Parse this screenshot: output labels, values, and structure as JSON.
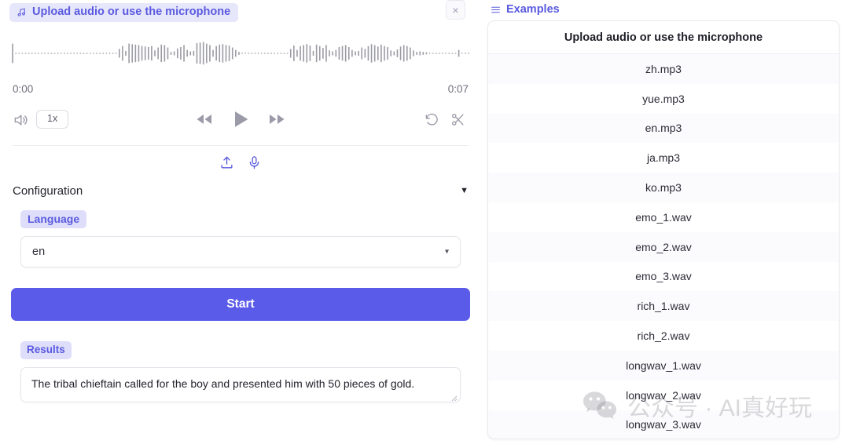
{
  "left": {
    "file_badge": {
      "label": "Upload audio or use the microphone",
      "icon": "music-note-icon"
    },
    "close_icon": "×",
    "player": {
      "time_start": "0:00",
      "time_end": "0:07",
      "speed": "1x",
      "volume_icon": "volume-icon",
      "rewind_icon": "rewind-icon",
      "play_icon": "play-icon",
      "forward_icon": "fast-forward-icon",
      "undo_icon": "undo-icon",
      "trim_icon": "scissors-icon"
    },
    "io": {
      "upload_icon": "upload-icon",
      "mic_icon": "microphone-icon"
    },
    "config": {
      "title": "Configuration",
      "caret": "▼",
      "language_label": "Language",
      "language_value": "en",
      "language_caret": "▾"
    },
    "start_label": "Start",
    "results_label": "Results",
    "results_text": "The tribal chieftain called for the boy and presented him with 50 pieces of gold."
  },
  "right": {
    "header_icon": "list-icon",
    "header_label": "Examples",
    "column_header": "Upload audio or use the microphone",
    "rows": [
      "zh.mp3",
      "yue.mp3",
      "en.mp3",
      "ja.mp3",
      "ko.mp3",
      "emo_1.wav",
      "emo_2.wav",
      "emo_3.wav",
      "rich_1.wav",
      "rich_2.wav",
      "longwav_1.wav",
      "longwav_2.wav",
      "longwav_3.wav"
    ]
  },
  "watermark": {
    "wechat_text": "公众号 · AI真好玩",
    "logo": "wechat-logo"
  },
  "colors": {
    "accent": "#5a5ae0",
    "accent_button": "#5b5bea",
    "badge_bg": "#dedefb",
    "waveform": "#9a9aa3",
    "row_alt": "#fbfbfd"
  },
  "waveform": {
    "bars": [
      40,
      2,
      2,
      2,
      2,
      2,
      2,
      2,
      2,
      2,
      2,
      2,
      2,
      2,
      2,
      2,
      2,
      2,
      2,
      2,
      2,
      2,
      2,
      2,
      2,
      2,
      2,
      2,
      2,
      2,
      2,
      2,
      2,
      18,
      30,
      10,
      40,
      38,
      36,
      34,
      30,
      28,
      26,
      30,
      12,
      24,
      36,
      34,
      24,
      6,
      8,
      20,
      26,
      34,
      14,
      8,
      10,
      42,
      44,
      46,
      40,
      34,
      14,
      30,
      36,
      38,
      34,
      32,
      24,
      14,
      6,
      2,
      2,
      2,
      2,
      2,
      2,
      2,
      2,
      2,
      2,
      2,
      2,
      2,
      2,
      2,
      18,
      32,
      14,
      30,
      34,
      38,
      32,
      10,
      36,
      30,
      22,
      34,
      12,
      8,
      14,
      26,
      30,
      34,
      26,
      14,
      8,
      10,
      24,
      18,
      30,
      38,
      34,
      28,
      36,
      30,
      26,
      12,
      8,
      16,
      28,
      34,
      30,
      24,
      12,
      6,
      8,
      6,
      4,
      2,
      2,
      2,
      2,
      2,
      2,
      2,
      2,
      2,
      14,
      2,
      2,
      2
    ]
  }
}
